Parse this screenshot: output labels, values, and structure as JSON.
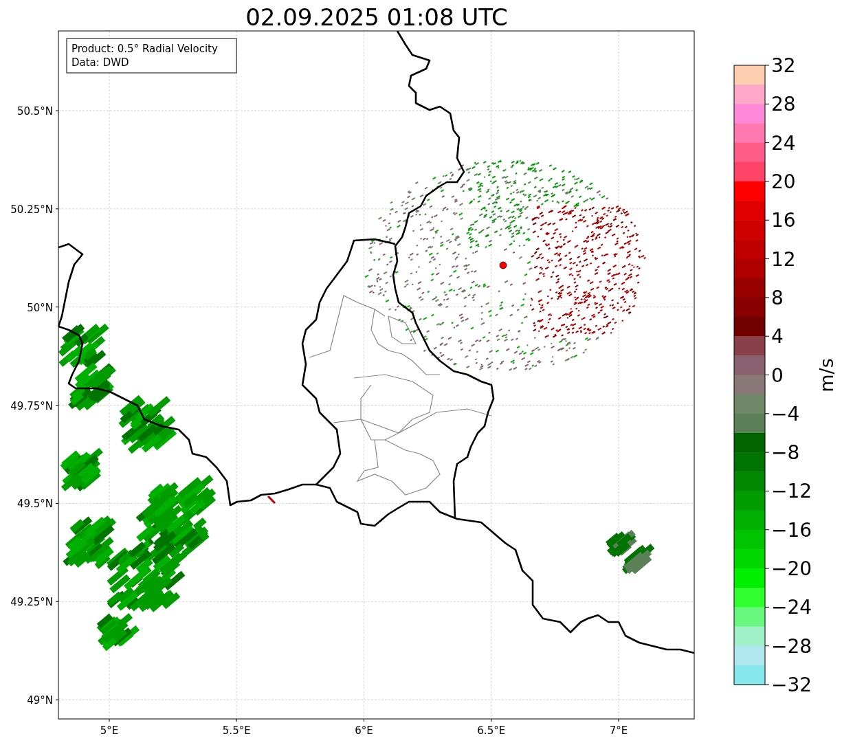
{
  "title": "02.09.2025 01:08 UTC",
  "info_box": {
    "lines": [
      "Product: 0.5° Radial Velocity",
      "Data: DWD"
    ]
  },
  "map": {
    "kind": "map",
    "y_ticks": [
      "50.5°N",
      "50.25°N",
      "50°N",
      "49.75°N",
      "49.5°N",
      "49.25°N",
      "49°N"
    ],
    "x_ticks": [
      "5°E",
      "5.5°E",
      "6°E",
      "6.5°E",
      "7°E"
    ]
  },
  "colorbar": {
    "label": "m/s",
    "ticks": [
      "32",
      "28",
      "24",
      "20",
      "16",
      "12",
      "8",
      "4",
      "0",
      "−4",
      "−8",
      "−12",
      "−16",
      "−20",
      "−24",
      "−28",
      "−32"
    ]
  }
}
